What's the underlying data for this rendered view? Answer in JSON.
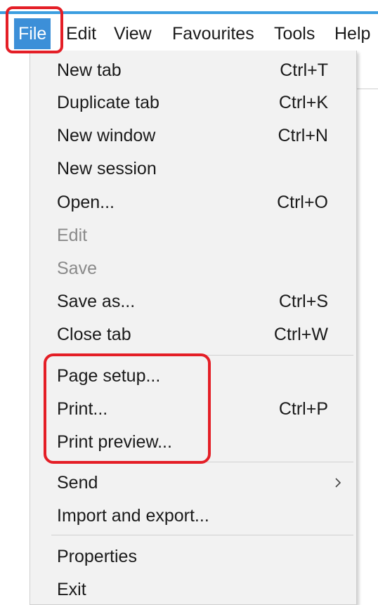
{
  "colors": {
    "accent": "#3c9ee0",
    "menu_active": "#3c8fd8",
    "highlight": "#e41e26",
    "menu_bg": "#f2f2f2",
    "disabled_text": "#8a8a8a"
  },
  "menubar": {
    "items": [
      {
        "label": "File",
        "active": true
      },
      {
        "label": "Edit"
      },
      {
        "label": "View"
      },
      {
        "label": "Favourites"
      },
      {
        "label": "Tools"
      },
      {
        "label": "Help"
      }
    ]
  },
  "file_menu": {
    "groups": [
      [
        {
          "label": "New tab",
          "shortcut": "Ctrl+T"
        },
        {
          "label": "Duplicate tab",
          "shortcut": "Ctrl+K"
        },
        {
          "label": "New window",
          "shortcut": "Ctrl+N"
        },
        {
          "label": "New session",
          "shortcut": ""
        },
        {
          "label": "Open...",
          "shortcut": "Ctrl+O"
        },
        {
          "label": "Edit",
          "shortcut": "",
          "disabled": true
        },
        {
          "label": "Save",
          "shortcut": "",
          "disabled": true
        },
        {
          "label": "Save as...",
          "shortcut": "Ctrl+S"
        },
        {
          "label": "Close tab",
          "shortcut": "Ctrl+W"
        }
      ],
      [
        {
          "label": "Page setup...",
          "shortcut": ""
        },
        {
          "label": "Print...",
          "shortcut": "Ctrl+P"
        },
        {
          "label": "Print preview...",
          "shortcut": ""
        }
      ],
      [
        {
          "label": "Send",
          "shortcut": "",
          "submenu": true,
          "icon": "chevron-right-icon"
        },
        {
          "label": "Import and export...",
          "shortcut": ""
        }
      ],
      [
        {
          "label": "Properties",
          "shortcut": ""
        },
        {
          "label": "Exit",
          "shortcut": ""
        }
      ]
    ]
  }
}
